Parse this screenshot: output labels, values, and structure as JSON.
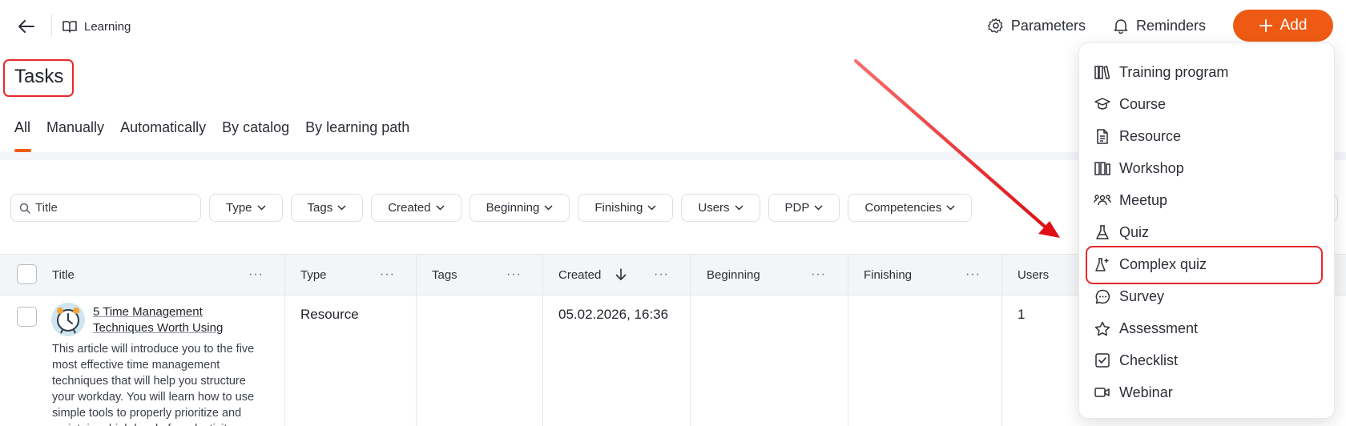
{
  "header": {
    "breadcrumb": "Learning",
    "parameters_label": "Parameters",
    "reminders_label": "Reminders",
    "add_label": "Add"
  },
  "page": {
    "title": "Tasks"
  },
  "tabs": [
    {
      "label": "All",
      "active": true
    },
    {
      "label": "Manually"
    },
    {
      "label": "Automatically"
    },
    {
      "label": "By catalog"
    },
    {
      "label": "By learning path"
    }
  ],
  "filters": {
    "search_placeholder": "Title",
    "chips": [
      "Type",
      "Tags",
      "Created",
      "Beginning",
      "Finishing",
      "Users",
      "PDP",
      "Competencies"
    ]
  },
  "table": {
    "columns": [
      "Title",
      "Type",
      "Tags",
      "Created",
      "Beginning",
      "Finishing",
      "Users"
    ],
    "rows": [
      {
        "title": "5 Time Management Techniques Worth Using",
        "description": "This article will introduce you to the five most effective time management techniques that will help you structure your workday. You will learn how to use simple tools to properly prioritize and maintain a high level of productivity.",
        "type": "Resource",
        "tags": "",
        "created": "05.02.2026, 16:36",
        "beginning": "",
        "finishing": "",
        "users": "1"
      }
    ]
  },
  "add_menu": {
    "items": [
      {
        "label": "Training program",
        "icon": "books-icon"
      },
      {
        "label": "Course",
        "icon": "graduation-cap-icon"
      },
      {
        "label": "Resource",
        "icon": "document-icon"
      },
      {
        "label": "Workshop",
        "icon": "workshop-icon"
      },
      {
        "label": "Meetup",
        "icon": "people-icon"
      },
      {
        "label": "Quiz",
        "icon": "flask-icon"
      },
      {
        "label": "Complex quiz",
        "icon": "flask-plus-icon",
        "highlighted": true
      },
      {
        "label": "Survey",
        "icon": "chat-icon"
      },
      {
        "label": "Assessment",
        "icon": "star-icon"
      },
      {
        "label": "Checklist",
        "icon": "checkbox-icon"
      },
      {
        "label": "Webinar",
        "icon": "video-icon"
      }
    ]
  },
  "colors": {
    "accent": "#ee5a13",
    "annotation": "#e8282b"
  }
}
